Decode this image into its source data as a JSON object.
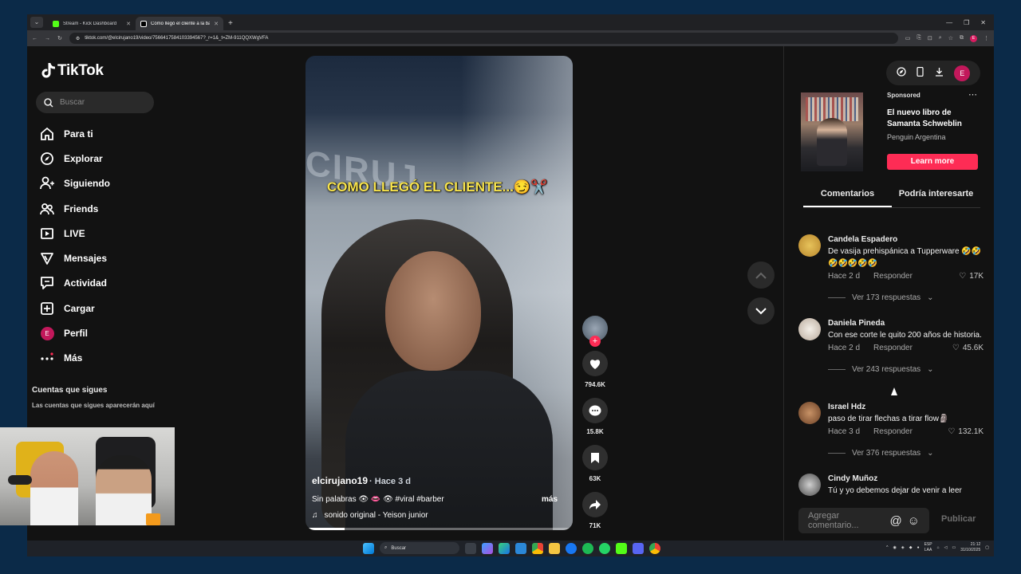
{
  "browser": {
    "tabs": [
      {
        "title": "Stream - Kick Dashboard",
        "color": "#53fc18"
      },
      {
        "title": "Cómo llegó el cliente a la barb",
        "color": "#ffffff"
      }
    ],
    "url": "tiktok.com/@elcirujano19/video/7566417584103394567?_r=1&_t=ZM-911QQXWgVFA",
    "profile_initial": "E"
  },
  "sidebar": {
    "logo": "TikTok",
    "search_placeholder": "Buscar",
    "items": [
      {
        "label": "Para ti",
        "icon": "home-icon"
      },
      {
        "label": "Explorar",
        "icon": "compass-icon"
      },
      {
        "label": "Siguiendo",
        "icon": "user-follow-icon"
      },
      {
        "label": "Friends",
        "icon": "friends-icon"
      },
      {
        "label": "LIVE",
        "icon": "live-icon"
      },
      {
        "label": "Mensajes",
        "icon": "send-icon"
      },
      {
        "label": "Actividad",
        "icon": "activity-icon"
      },
      {
        "label": "Cargar",
        "icon": "upload-icon"
      },
      {
        "label": "Perfil",
        "icon": "avatar"
      },
      {
        "label": "Más",
        "icon": "more-icon"
      }
    ],
    "profile_initial": "E",
    "following_title": "Cuentas que sigues",
    "following_hint": "Las cuentas que sigues aparecerán aquí"
  },
  "video": {
    "overlay_text": "COMO LLEGÓ EL CLIENTE...😏✂️",
    "username": "elcirujano19",
    "time": "· Hace 3 d",
    "description": "Sin palabras 👁 👄 👁 #viral #barber",
    "more": "más",
    "sound": "sonido original - Yeison junior",
    "progress": 0.14
  },
  "actions": {
    "likes": "794.6K",
    "comments": "15.8K",
    "saves": "63K",
    "shares": "71K"
  },
  "right": {
    "profile_initial": "E",
    "ad": {
      "label": "Sponsored",
      "title": "El nuevo libro de Samanta Schweblin",
      "advertiser": "Penguin Argentina",
      "cta": "Learn more"
    },
    "tabs": [
      "Comentarios",
      "Podría interesarte"
    ],
    "comments": [
      {
        "name": "Candela Espadero",
        "text": "De vasija prehispánica a Tupperware 🤣🤣🤣🤣🤣🤣🤣",
        "time": "Hace 2 d",
        "reply": "Responder",
        "likes": "17K",
        "replies": "Ver 173 respuestas",
        "avatar": "#d4a73a"
      },
      {
        "name": "Daniela Pineda",
        "text": "Con ese corte le quito 200 años de historia.",
        "time": "Hace 2 d",
        "reply": "Responder",
        "likes": "45.6K",
        "replies": "Ver 243 respuestas",
        "avatar": "#e6e2dc"
      },
      {
        "name": "Israel Hdz",
        "text": "paso de tirar flechas a tirar flow🗿",
        "time": "Hace 3 d",
        "reply": "Responder",
        "likes": "132.1K",
        "replies": "Ver 376 respuestas",
        "avatar": "#a8774f"
      },
      {
        "name": "Cindy Muñoz",
        "text": "Tú y yo debemos dejar de venir a leer",
        "avatar": "#8a8a8a"
      }
    ],
    "comment_placeholder": "Agregar comentario...",
    "publish": "Publicar"
  },
  "taskbar": {
    "search": "Buscar",
    "lang1": "ESP",
    "lang2": "LAA",
    "time": "21:12",
    "date": "31/10/2025"
  },
  "colors": {
    "accent": "#fe2c55",
    "overlay_text": "#f7e34b"
  }
}
